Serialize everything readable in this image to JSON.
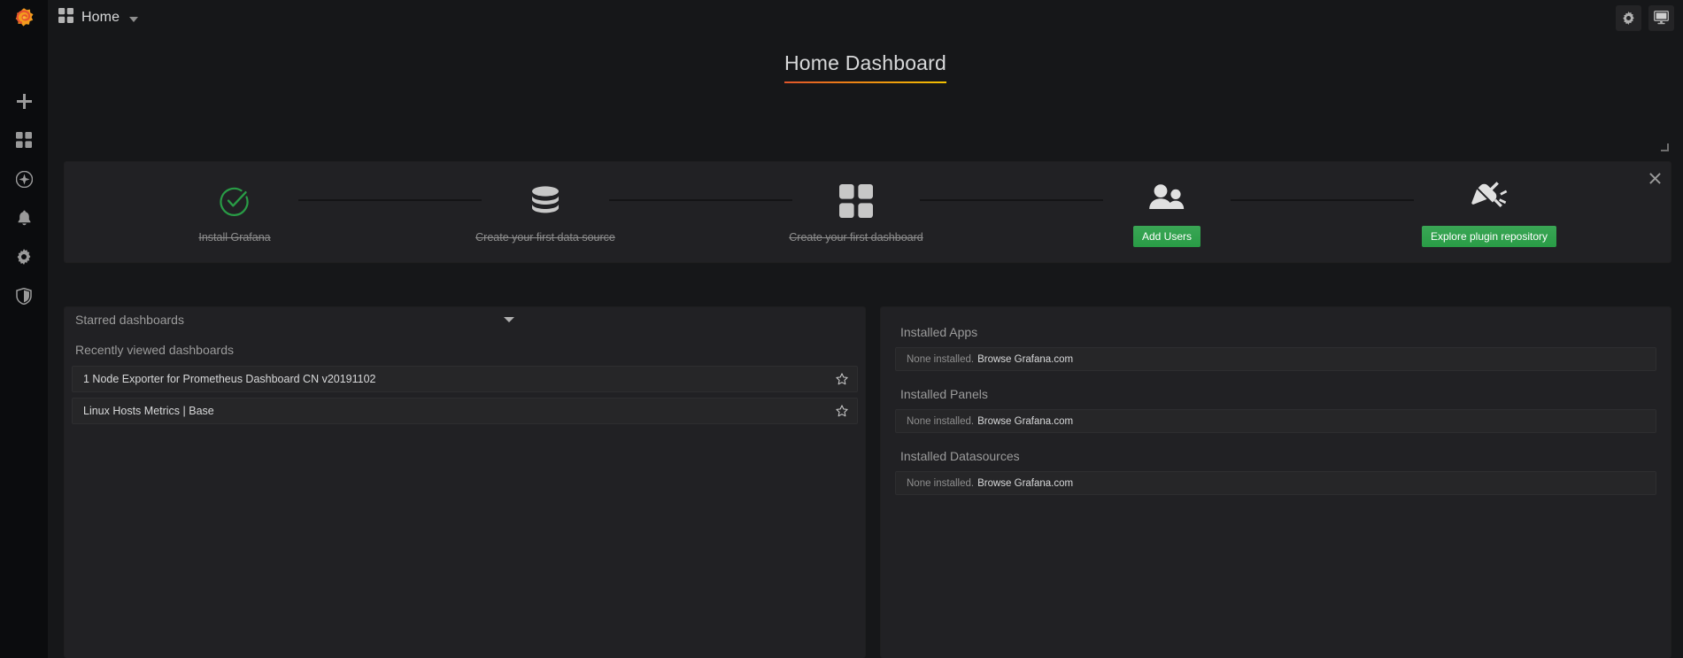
{
  "brand": {
    "logo": "grafana-logo"
  },
  "topbar": {
    "grid_icon": "dashboard-grid-icon",
    "breadcrumb": "Home",
    "caret_icon": "chevron-down-icon",
    "settings_icon": "gear-icon",
    "kiosk_icon": "monitor-icon"
  },
  "sidebar": {
    "items": [
      {
        "name": "create",
        "icon": "plus-icon"
      },
      {
        "name": "dashboards",
        "icon": "dashboard-grid-icon"
      },
      {
        "name": "explore",
        "icon": "compass-icon"
      },
      {
        "name": "alerting",
        "icon": "bell-icon"
      },
      {
        "name": "configuration",
        "icon": "gear-icon"
      },
      {
        "name": "server-admin",
        "icon": "shield-icon"
      }
    ]
  },
  "dashboard": {
    "title": "Home Dashboard"
  },
  "getting_started": {
    "close_icon": "close-icon",
    "steps": [
      {
        "icon": "check-circle-icon",
        "label": "Install Grafana",
        "done": true,
        "button": null
      },
      {
        "icon": "database-icon",
        "label": "Create your first data source",
        "done": true,
        "button": null
      },
      {
        "icon": "dashboard-grid-icon",
        "label": "Create your first dashboard",
        "done": true,
        "button": null
      },
      {
        "icon": "users-icon",
        "label": null,
        "done": false,
        "button": "Add Users"
      },
      {
        "icon": "plug-icon",
        "label": null,
        "done": false,
        "button": "Explore plugin repository"
      }
    ]
  },
  "left_panel": {
    "starred_label": "Starred dashboards",
    "collapse_icon": "chevron-down-icon",
    "recent_label": "Recently viewed dashboards",
    "dashboards": [
      {
        "name": "1 Node Exporter for Prometheus Dashboard CN v20191102",
        "star_icon": "star-outline-icon"
      },
      {
        "name": "Linux Hosts Metrics | Base",
        "star_icon": "star-outline-icon"
      }
    ]
  },
  "right_panel": {
    "groups": [
      {
        "title": "Installed Apps",
        "empty_text": "None installed.",
        "link_text": "Browse Grafana.com"
      },
      {
        "title": "Installed Panels",
        "empty_text": "None installed.",
        "link_text": "Browse Grafana.com"
      },
      {
        "title": "Installed Datasources",
        "empty_text": "None installed.",
        "link_text": "Browse Grafana.com"
      }
    ]
  },
  "colors": {
    "background": "#161719",
    "sidebar": "#0b0c0e",
    "panel": "#212124",
    "green": "#299c46",
    "accent_orange": "#eb7b18",
    "text": "#d8d9da",
    "text_muted": "#8e8e8e"
  }
}
